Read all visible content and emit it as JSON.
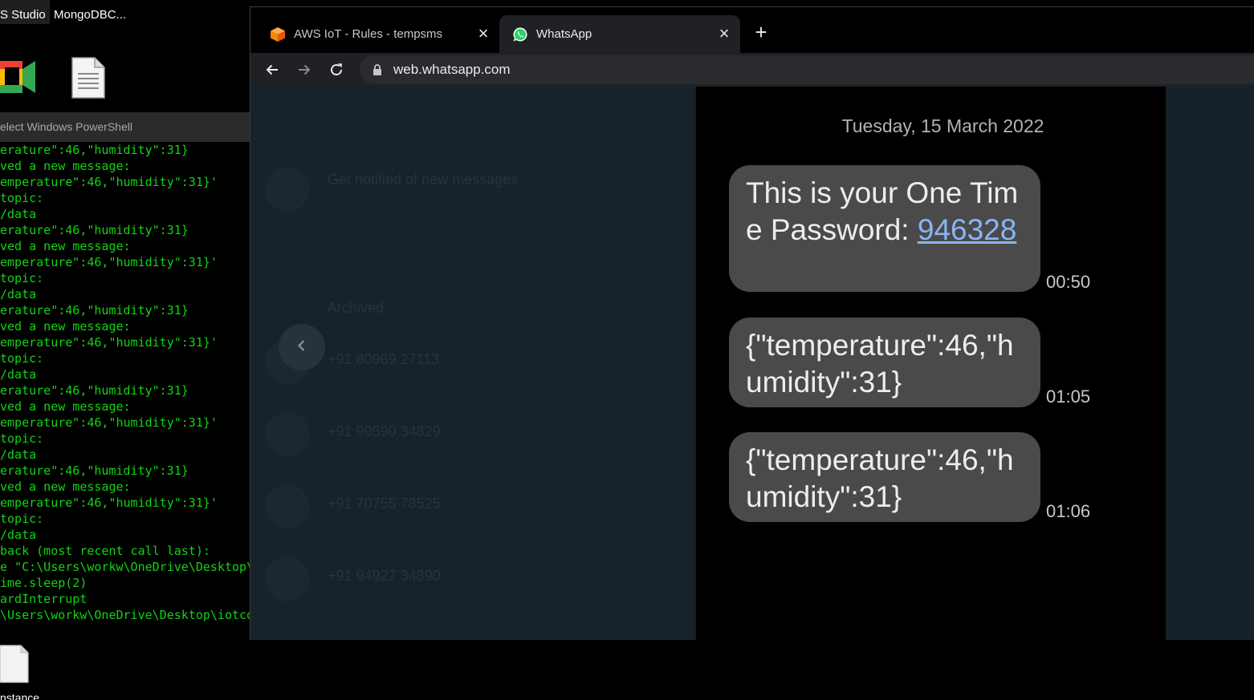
{
  "desktop": {
    "icons": [
      {
        "label": "S Studio"
      },
      {
        "label": "MongoDBC..."
      },
      {
        "label": "nstance"
      }
    ]
  },
  "powershell": {
    "title": "elect Windows PowerShell",
    "lines": [
      "erature\":46,\"humidity\":31}",
      "ved a new message:",
      "emperature\":46,\"humidity\":31}'",
      "topic:",
      "/data",
      "erature\":46,\"humidity\":31}",
      "ved a new message:",
      "emperature\":46,\"humidity\":31}'",
      "topic:",
      "/data",
      "erature\":46,\"humidity\":31}",
      "ved a new message:",
      "emperature\":46,\"humidity\":31}'",
      "topic:",
      "/data",
      "erature\":46,\"humidity\":31}",
      "ved a new message:",
      "emperature\":46,\"humidity\":31}'",
      "topic:",
      "/data",
      "erature\":46,\"humidity\":31}",
      "ved a new message:",
      "emperature\":46,\"humidity\":31}'",
      "topic:",
      "/data",
      "back (most recent call last):",
      "e \"C:\\Users\\workw\\OneDrive\\Desktop\\",
      "ime.sleep(2)",
      "ardInterrupt",
      "\\Users\\workw\\OneDrive\\Desktop\\iotco"
    ]
  },
  "browser": {
    "tabs": [
      {
        "title": "AWS IoT - Rules - tempsms",
        "icon": "aws-cube-icon"
      },
      {
        "title": "WhatsApp",
        "icon": "whatsapp-icon"
      }
    ],
    "url": "web.whatsapp.com"
  },
  "whatsapp_bg": {
    "notify": "Get notified of new messages",
    "archived": "Archived",
    "contacts": [
      "+91 80969 27113",
      "+91 99590 34829",
      "+91 70755 78525",
      "+91 94927 34890"
    ]
  },
  "sms": {
    "date": "Tuesday, 15 March 2022",
    "messages": [
      {
        "text": "This is your One Time Password: ",
        "link": "946328",
        "time": "00:50"
      },
      {
        "text": "{\"temperature\":46,\"humidity\":31}",
        "time": "01:05"
      },
      {
        "text": "{\"temperature\":46,\"humidity\":31}",
        "time": "01:06"
      }
    ]
  },
  "colors": {
    "terminal_text": "#12d312",
    "bubble": "#4a4a4a",
    "link": "#8ab4f8",
    "tab_active": "#202124"
  }
}
